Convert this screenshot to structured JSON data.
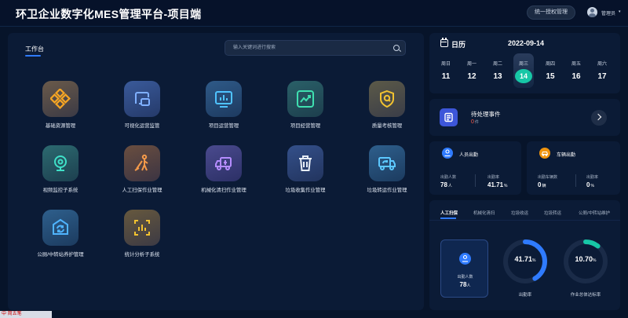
{
  "header": {
    "title": "环卫企业数字化MES管理平台-项目端",
    "sso_button": "统一授权管理",
    "user_name": "管理员",
    "user_caret": "▾"
  },
  "workspace": {
    "tab_label": "工作台",
    "search_placeholder": "输入关键词进行搜索",
    "tiles": [
      {
        "label": "基础资源管理",
        "icon": "diamond-grid-icon"
      },
      {
        "label": "可视化运营监管",
        "icon": "monitor-icon"
      },
      {
        "label": "项目运营管理",
        "icon": "bar-chart-icon"
      },
      {
        "label": "项目经营管理",
        "icon": "trend-chart-icon"
      },
      {
        "label": "质量考核管理",
        "icon": "shield-icon"
      },
      {
        "label": "视频监控子系统",
        "icon": "camera-icon"
      },
      {
        "label": "人工扫保作业管理",
        "icon": "sweeper-icon"
      },
      {
        "label": "机械化清扫作业管理",
        "icon": "truck-icon"
      },
      {
        "label": "垃圾收集作业管理",
        "icon": "trash-bin-icon"
      },
      {
        "label": "垃圾转运作业管理",
        "icon": "recycle-truck-icon"
      },
      {
        "label": "公厕/中转站养护管理",
        "icon": "refresh-box-icon"
      },
      {
        "label": "统计分析子系统",
        "icon": "stats-icon"
      }
    ]
  },
  "calendar": {
    "title": "日历",
    "date": "2022-09-14",
    "days": [
      {
        "name": "周日",
        "num": "11"
      },
      {
        "name": "周一",
        "num": "12"
      },
      {
        "name": "周二",
        "num": "13"
      },
      {
        "name": "周三",
        "num": "14",
        "active": true
      },
      {
        "name": "周四",
        "num": "15"
      },
      {
        "name": "周五",
        "num": "16"
      },
      {
        "name": "周六",
        "num": "17"
      }
    ]
  },
  "pending": {
    "label": "待处理事件",
    "count": "0",
    "unit": "件"
  },
  "staff": {
    "title": "人员出勤",
    "stat1_label": "出勤人数",
    "stat1_value": "78",
    "stat1_unit": "人",
    "stat2_label": "出勤率",
    "stat2_value": "41.71",
    "stat2_unit": "%"
  },
  "vehicle": {
    "title": "车辆出勤",
    "stat1_label": "出勤车辆数",
    "stat1_value": "0",
    "stat1_unit": "辆",
    "stat2_label": "出勤率",
    "stat2_value": "0",
    "stat2_unit": "%"
  },
  "ops": {
    "tabs": [
      "人工扫保",
      "机械化清扫",
      "垃圾收运",
      "垃圾转运",
      "公厕/中转站维护"
    ],
    "card_label": "出勤人数",
    "card_value": "78",
    "card_unit": "人",
    "ring1_value": "41.71",
    "ring1_unit": "%",
    "ring1_fraction": 0.4171,
    "ring1_label": "出勤率",
    "ring2_value": "10.70",
    "ring2_unit": "%",
    "ring2_fraction": 0.107,
    "ring2_label": "作业总体达标率"
  },
  "colors": {
    "accent_blue": "#2f7bff",
    "accent_teal": "#17c7a6",
    "alert_red": "#ff5b4a",
    "staff_icon": "#2f7bff",
    "vehicle_icon": "#f0940e"
  },
  "taskbar": {
    "text": "中 简五笔"
  }
}
